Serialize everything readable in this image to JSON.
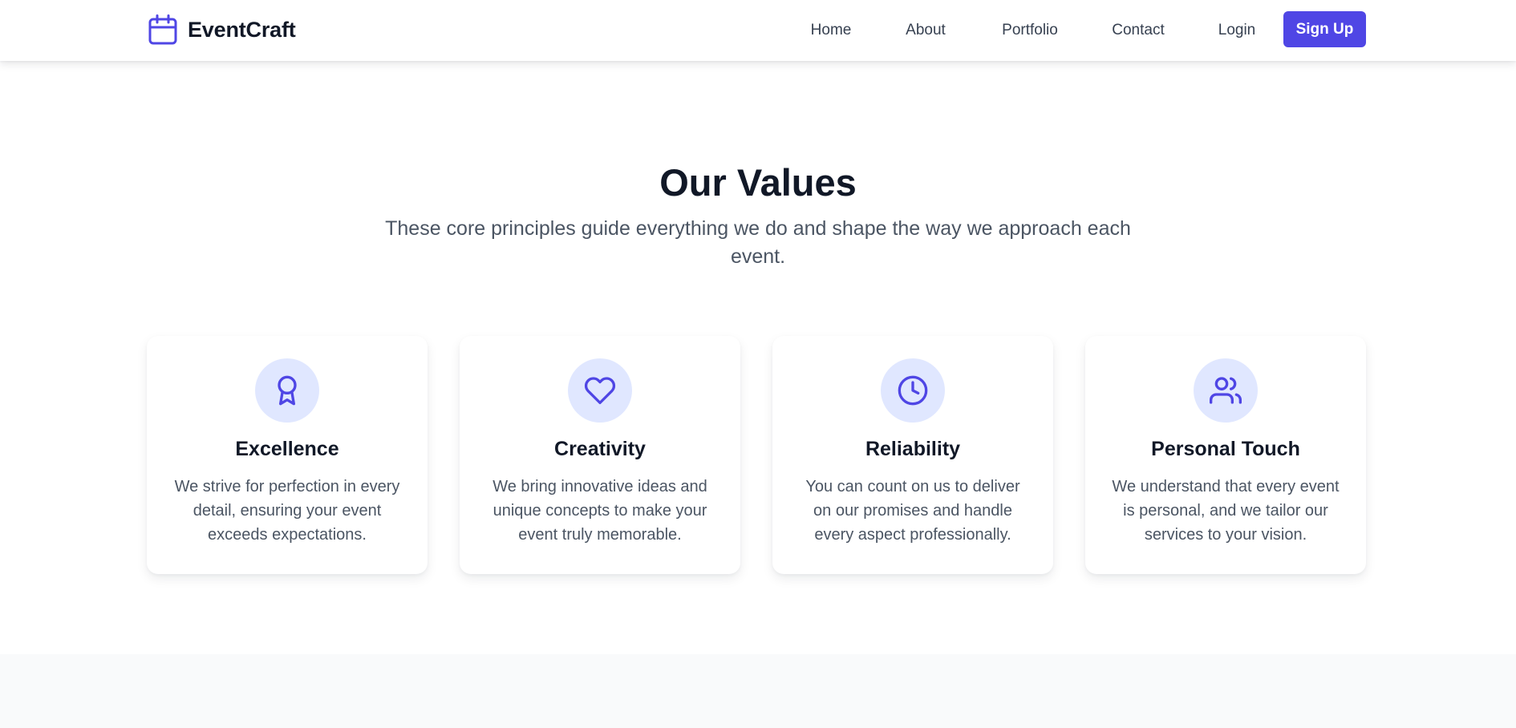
{
  "brand": {
    "name": "EventCraft",
    "icon": "calendar-icon",
    "color": "#4f46e5"
  },
  "nav": {
    "links": [
      {
        "label": "Home"
      },
      {
        "label": "About"
      },
      {
        "label": "Portfolio"
      },
      {
        "label": "Contact"
      },
      {
        "label": "Login"
      }
    ],
    "signup_label": "Sign Up"
  },
  "values": {
    "title": "Our Values",
    "subtitle": "These core principles guide everything we do and shape the way we approach each event.",
    "cards": [
      {
        "icon": "award-icon",
        "title": "Excellence",
        "description": "We strive for perfection in every detail, ensuring your event exceeds expectations."
      },
      {
        "icon": "heart-icon",
        "title": "Creativity",
        "description": "We bring innovative ideas and unique concepts to make your event truly memorable."
      },
      {
        "icon": "clock-icon",
        "title": "Reliability",
        "description": "You can count on us to deliver on our promises and handle every aspect professionally."
      },
      {
        "icon": "users-icon",
        "title": "Personal Touch",
        "description": "We understand that every event is personal, and we tailor our services to your vision."
      }
    ]
  },
  "colors": {
    "accent": "#4f46e5",
    "icon_bg": "#e0e7ff",
    "heading": "#111827",
    "body_text": "#4b5563",
    "next_section_bg": "#f9fafb"
  }
}
